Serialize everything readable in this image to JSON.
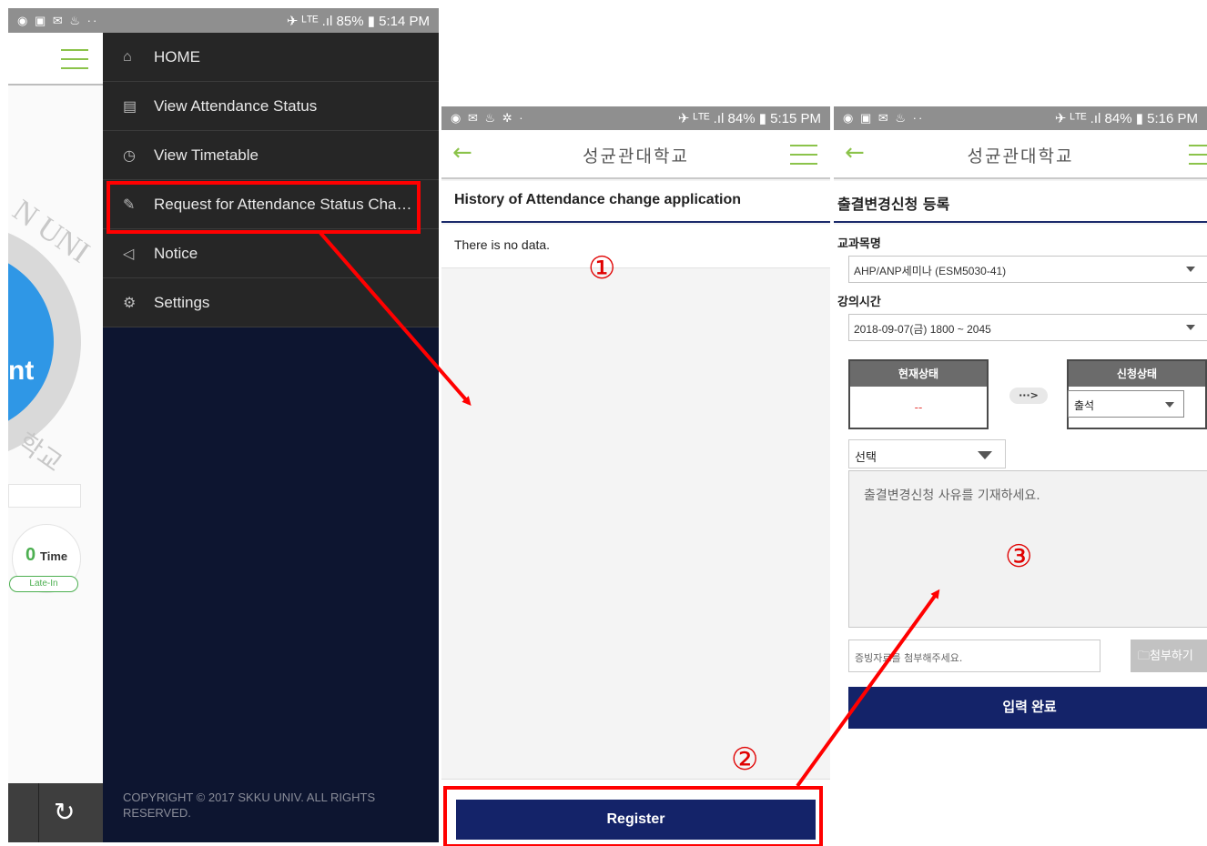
{
  "panel1": {
    "status": {
      "icons": "◉ ▣ ✉ ♨ ··",
      "right": "✈ ᴸᵀᴱ .ıl 85% ▮ 5:14 PM"
    },
    "background": {
      "watermark": "N UNI",
      "watermark2": "학교",
      "big_text": "nt",
      "time_count": "0",
      "time_unit": "Time",
      "late_in_label": "Late-In"
    },
    "menu": [
      {
        "icon": "home-icon",
        "glyph": "⌂",
        "label": "HOME"
      },
      {
        "icon": "book-icon",
        "glyph": "▤",
        "label": "View Attendance Status"
      },
      {
        "icon": "clock-icon",
        "glyph": "◷",
        "label": "View Timetable"
      },
      {
        "icon": "edit-icon",
        "glyph": "✎",
        "label": "Request for Attendance Status Chan..."
      },
      {
        "icon": "speaker-icon",
        "glyph": "◁",
        "label": "Notice"
      },
      {
        "icon": "gear-icon",
        "glyph": "⚙",
        "label": "Settings"
      }
    ],
    "copyright": "COPYRIGHT © 2017 SKKU UNIV. ALL RIGHTS RESERVED.",
    "refresh_glyph": "↻"
  },
  "panel2": {
    "status": {
      "icons": "◉ ✉ ♨ ✲ ·",
      "right": "✈ ᴸᵀᴱ .ıl 84% ▮ 5:15 PM"
    },
    "back_glyph": "←",
    "header_title": "성균관대학교",
    "section_title": "History of Attendance change application",
    "empty_text": "There is no data.",
    "register_label": "Register"
  },
  "panel3": {
    "status": {
      "icons": "◉ ▣ ✉ ♨ ··",
      "right": "✈ ᴸᵀᴱ .ıl 84% ▮ 5:16 PM"
    },
    "back_glyph": "←",
    "header_title": "성균관대학교",
    "section_title": "출결변경신청 등록",
    "course_label": "교과목명",
    "course_value": "AHP/ANP세미나 (ESM5030-41)",
    "time_label": "강의시간",
    "time_value": "2018-09-07(금) 1800 ~ 2045",
    "current_status_label": "현재상태",
    "current_status_value": "--",
    "arrow_text": "···>",
    "request_status_label": "신청상태",
    "request_status_value": "출석",
    "choose_value": "선택",
    "reason_placeholder": "출결변경신청 사유를 기재하세요.",
    "attach_placeholder": "증빙자료를 첨부해주세요.",
    "attach_button": "🗀첨부하기",
    "submit_label": "입력 완료"
  },
  "annotations": {
    "marker1": "①",
    "marker2": "②",
    "marker3": "③",
    "highlight_color": "#ff0000"
  }
}
